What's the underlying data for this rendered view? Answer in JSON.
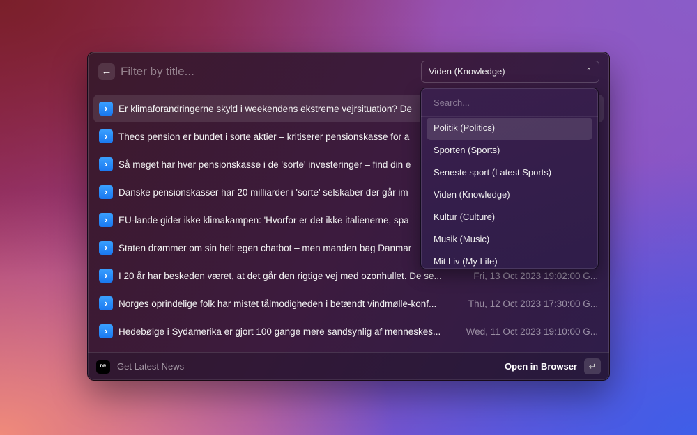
{
  "header": {
    "back_icon": "arrow-left-icon",
    "filter_placeholder": "Filter by title...",
    "category": "Viden (Knowledge)"
  },
  "rows": [
    {
      "title": "Er klimaforandringerne skyld i weekendens ekstreme vejrsituation? De",
      "date": ""
    },
    {
      "title": "Theos pension er bundet i sorte aktier – kritiserer pensionskasse for a",
      "date": ""
    },
    {
      "title": "Så meget har hver pensionskasse i de 'sorte' investeringer – find din e",
      "date": ""
    },
    {
      "title": "Danske pensionskasser har 20 milliarder i 'sorte' selskaber der går im",
      "date": ""
    },
    {
      "title": "EU-lande gider ikke klimakampen: 'Hvorfor er det ikke italienerne, spa",
      "date": ""
    },
    {
      "title": "Staten drømmer om sin helt egen chatbot – men manden bag Danmar",
      "date": ""
    },
    {
      "title": "I 20 år har beskeden været, at det går den rigtige vej med ozonhullet. De se...",
      "date": "Fri, 13 Oct 2023 19:02:00 G..."
    },
    {
      "title": "Norges oprindelige folk har mistet tålmodigheden i betændt vindmølle-konf...",
      "date": "Thu, 12 Oct 2023 17:30:00 G..."
    },
    {
      "title": "Hedebølge i Sydamerika er gjort 100 gange mere sandsynlig af menneskes...",
      "date": "Wed, 11 Oct 2023 19:10:00 G..."
    }
  ],
  "footer": {
    "logo": "DR",
    "command": "Get Latest News",
    "action": "Open in Browser",
    "enter_key": "↵"
  },
  "dropdown": {
    "search_placeholder": "Search...",
    "options": [
      "Politik (Politics)",
      "Sporten (Sports)",
      "Seneste sport (Latest Sports)",
      "Viden (Knowledge)",
      "Kultur (Culture)",
      "Musik (Music)",
      "Mit Liv (My Life)"
    ]
  }
}
